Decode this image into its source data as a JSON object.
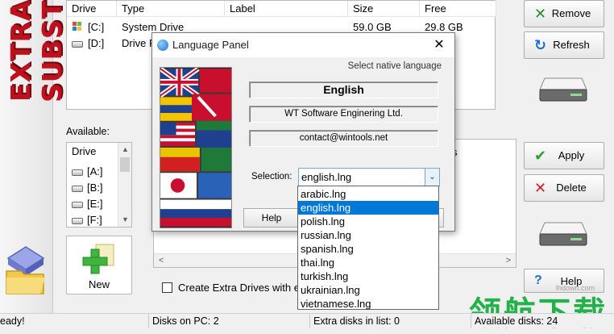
{
  "app": {
    "banner_text": "EXTRA SUBST"
  },
  "drives_table": {
    "columns": [
      "Drive",
      "Type",
      "Label",
      "Size",
      "Free"
    ],
    "rows": [
      {
        "drive": "[C:]",
        "type": "System Drive",
        "label": "",
        "size": "59.0 GB",
        "free": "29.8 GB"
      },
      {
        "drive": "[D:]",
        "type": "Drive F",
        "label": "",
        "size": "",
        "free": ""
      }
    ]
  },
  "available": {
    "label": "Available:",
    "column": "Drive",
    "items": [
      "[A:]",
      "[B:]",
      "[E:]",
      "[F:]"
    ]
  },
  "new_tile": {
    "label": "New"
  },
  "right_buttons": {
    "remove": "Remove",
    "refresh": "Refresh",
    "apply": "Apply",
    "delete": "Delete",
    "help": "Help"
  },
  "lower_list": {
    "partial_text": "s"
  },
  "checkbox": {
    "label": "Create Extra Drives with e",
    "checked": false
  },
  "status_bar": {
    "ready": "eady!",
    "disks_on_pc": "Disks on PC: 2",
    "extra_disks": "Extra disks in list: 0",
    "available_disks": "Available disks: 24"
  },
  "dialog": {
    "title": "Language Panel",
    "native_label": "Select native language",
    "language_name": "English",
    "company": "WT Software Enginering Ltd.",
    "contact": "contact@wintools.net",
    "selection_label": "Selection:",
    "selection_value": "english.lng",
    "help_label": "Help",
    "options": [
      "arabic.lng",
      "english.lng",
      "polish.lng",
      "russian.lng",
      "spanish.lng",
      "thai.lng",
      "turkish.lng",
      "ukrainian.lng",
      "vietnamese.lng"
    ],
    "selected_index": 1
  },
  "watermark": {
    "text": "领航下载",
    "site": "lhdown.com"
  },
  "colors": {
    "banner_red": "#c0101e",
    "highlight": "#0078d7",
    "watermark_green": "#22b24a"
  }
}
